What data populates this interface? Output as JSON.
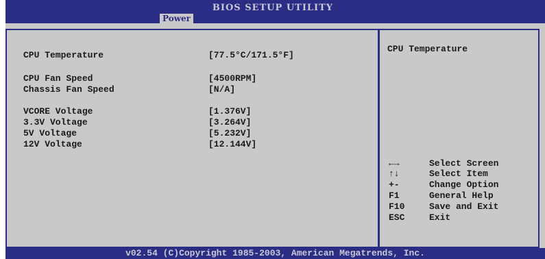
{
  "header": {
    "title": "BIOS SETUP UTILITY",
    "active_tab": "Power"
  },
  "main": {
    "items": [
      {
        "label": "CPU Temperature",
        "value": "[77.5°C/171.5°F]"
      },
      {
        "label": "CPU Fan Speed",
        "value": "[4500RPM]"
      },
      {
        "label": "Chassis Fan Speed",
        "value": "[N/A]"
      },
      {
        "label": "VCORE Voltage",
        "value": "[1.376V]"
      },
      {
        "label": "3.3V Voltage",
        "value": "[3.264V]"
      },
      {
        "label": "5V Voltage",
        "value": "[5.232V]"
      },
      {
        "label": "12V Voltage",
        "value": "[12.144V]"
      }
    ]
  },
  "help": {
    "title": "CPU Temperature",
    "keys": [
      {
        "key": "←→",
        "desc": "Select Screen"
      },
      {
        "key": "↑↓",
        "desc": "Select Item"
      },
      {
        "key": "+-",
        "desc": "Change Option"
      },
      {
        "key": "F1",
        "desc": "General Help"
      },
      {
        "key": "F10",
        "desc": "Save and Exit"
      },
      {
        "key": "ESC",
        "desc": "Exit"
      }
    ]
  },
  "footer": {
    "copyright": "v02.54 (C)Copyright 1985-2003, American Megatrends, Inc."
  }
}
